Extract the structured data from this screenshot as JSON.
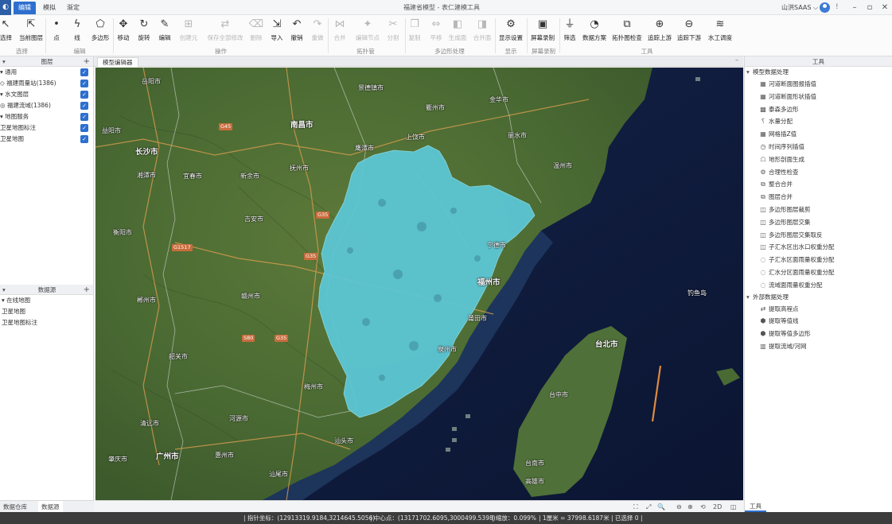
{
  "titlebar": {
    "menu_tabs": [
      "编辑",
      "模拟",
      "渐定"
    ],
    "title": "福建省模型 - 表仁建模工具",
    "user": "山洪SAAS ⌵",
    "info": "!",
    "window_buttons": [
      "–",
      "▫",
      "✕"
    ]
  },
  "ribbon": {
    "tools": [
      {
        "label": "选择",
        "icon": "↖",
        "dim": false
      },
      {
        "label": "当前图层",
        "icon": "⇱",
        "dim": false
      },
      {
        "label": "点",
        "icon": "•",
        "dim": false
      },
      {
        "label": "线",
        "icon": "ϟ",
        "dim": false
      },
      {
        "label": "多边形",
        "icon": "⬠",
        "dim": false
      },
      {
        "label": "移动",
        "icon": "✥",
        "dim": false
      },
      {
        "label": "旋转",
        "icon": "↻",
        "dim": false
      },
      {
        "label": "编辑",
        "icon": "✎",
        "dim": false
      },
      {
        "label": "创建元",
        "icon": "⊞",
        "dim": true
      },
      {
        "label": "保存全部修改",
        "icon": "⇄",
        "dim": true
      },
      {
        "label": "删除",
        "icon": "⌫",
        "dim": true
      },
      {
        "label": "导入",
        "icon": "⇲",
        "dim": false
      },
      {
        "label": "撤销",
        "icon": "↶",
        "dim": false
      },
      {
        "label": "重做",
        "icon": "↷",
        "dim": true
      },
      {
        "label": "合并",
        "icon": "⋈",
        "dim": true
      },
      {
        "label": "编辑节点",
        "icon": "✦",
        "dim": true
      },
      {
        "label": "分割",
        "icon": "✂",
        "dim": true
      },
      {
        "label": "复制",
        "icon": "❐",
        "dim": true
      },
      {
        "label": "平移",
        "icon": "⇔",
        "dim": true
      },
      {
        "label": "生成面",
        "icon": "◧",
        "dim": true
      },
      {
        "label": "合并面",
        "icon": "◨",
        "dim": true
      },
      {
        "label": "显示设置",
        "icon": "⚙",
        "dim": false
      },
      {
        "label": "屏幕录制",
        "icon": "▣",
        "dim": false
      },
      {
        "label": "筛选",
        "icon": "⏚",
        "dim": false
      },
      {
        "label": "数据方案",
        "icon": "◔",
        "dim": false
      },
      {
        "label": "拓扑图检查",
        "icon": "⧉",
        "dim": false
      },
      {
        "label": "追踪上游",
        "icon": "⊕",
        "dim": false
      },
      {
        "label": "追踪下游",
        "icon": "⊖",
        "dim": false
      },
      {
        "label": "水工调度",
        "icon": "≋",
        "dim": false
      }
    ],
    "groups": [
      "选择",
      "编辑",
      "操作",
      "拓扑管",
      "多边形处理",
      "显示",
      "屏幕录制",
      "工具"
    ]
  },
  "layers_panel": {
    "title": "图层",
    "rows": [
      {
        "text": "▾ 通用",
        "checked": true
      },
      {
        "text": "  ◇ 福建雨量站(1386)",
        "checked": true
      },
      {
        "text": "▾ 水文图层",
        "checked": true
      },
      {
        "text": "  ◎ 福建流域(1386)",
        "checked": true
      },
      {
        "text": "▾ 地图服务",
        "checked": true
      },
      {
        "text": "    卫星地图标注",
        "checked": true
      },
      {
        "text": "    卫星地图",
        "checked": true
      }
    ]
  },
  "datasource_panel": {
    "title": "数据源",
    "rows": [
      "▾ 在线地图",
      "  卫星地图",
      "  卫星地图标注"
    ]
  },
  "left_bottom_tabs": [
    "数据仓库",
    "数据源"
  ],
  "document_tab": "模型编辑器",
  "map": {
    "labels": [
      {
        "text": "岳阳市",
        "big": false
      },
      {
        "text": "景德镇市",
        "big": false
      },
      {
        "text": "衢州市",
        "big": false
      },
      {
        "text": "金华市",
        "big": false
      },
      {
        "text": "南昌市",
        "big": true
      },
      {
        "text": "益阳市",
        "big": false
      },
      {
        "text": "上饶市",
        "big": false
      },
      {
        "text": "丽水市",
        "big": false
      },
      {
        "text": "长沙市",
        "big": true
      },
      {
        "text": "鹰潭市",
        "big": false
      },
      {
        "text": "湘潭市",
        "big": false
      },
      {
        "text": "宜春市",
        "big": false
      },
      {
        "text": "新余市",
        "big": false
      },
      {
        "text": "抚州市",
        "big": false
      },
      {
        "text": "温州市",
        "big": false
      },
      {
        "text": "吉安市",
        "big": false
      },
      {
        "text": "衡阳市",
        "big": false
      },
      {
        "text": "宁德市",
        "big": false
      },
      {
        "text": "福州市",
        "big": true
      },
      {
        "text": "郴州市",
        "big": false
      },
      {
        "text": "赣州市",
        "big": false
      },
      {
        "text": "莆田市",
        "big": false
      },
      {
        "text": "钓鱼岛",
        "big": false
      },
      {
        "text": "泉州市",
        "big": false
      },
      {
        "text": "台北市",
        "big": true
      },
      {
        "text": "韶关市",
        "big": false
      },
      {
        "text": "梅州市",
        "big": false
      },
      {
        "text": "台中市",
        "big": false
      },
      {
        "text": "河源市",
        "big": false
      },
      {
        "text": "清远市",
        "big": false
      },
      {
        "text": "汕头市",
        "big": false
      },
      {
        "text": "广州市",
        "big": true
      },
      {
        "text": "惠州市",
        "big": false
      },
      {
        "text": "肇庆市",
        "big": false
      },
      {
        "text": "汕尾市",
        "big": false
      },
      {
        "text": "台南市",
        "big": false
      },
      {
        "text": "高雄市",
        "big": false
      }
    ],
    "road_shields": [
      "G45",
      "G35",
      "G1517",
      "G35",
      "S80",
      "G35"
    ]
  },
  "map_toolbar": [
    "⛶",
    "⤢",
    "🔍",
    "⊖",
    "⊕",
    "⟲",
    "2D",
    "◫"
  ],
  "tools_panel": {
    "title": "工具",
    "groups": [
      {
        "name": "模型数据处理",
        "items": [
          {
            "icon": "▦",
            "label": "河道断面图报插值"
          },
          {
            "icon": "▦",
            "label": "河道断面形状插值"
          },
          {
            "icon": "▩",
            "label": "泰森多边形"
          },
          {
            "icon": "⸮",
            "label": "水量分配"
          },
          {
            "icon": "▦",
            "label": "网格插Z值"
          },
          {
            "icon": "◷",
            "label": "时间序列插值"
          },
          {
            "icon": "☖",
            "label": "地形剖面生成"
          },
          {
            "icon": "⚙",
            "label": "合理性检查"
          },
          {
            "icon": "⧉",
            "label": "整合合并"
          },
          {
            "icon": "⧉",
            "label": "图层合并"
          },
          {
            "icon": "◫",
            "label": "多边形图层裁剪"
          },
          {
            "icon": "◫",
            "label": "多边形图层交集"
          },
          {
            "icon": "◫",
            "label": "多边形图层交集取反"
          },
          {
            "icon": "◫",
            "label": "子汇水区出水口权重分配"
          },
          {
            "icon": "◌",
            "label": "子汇水区面雨量权重分配"
          },
          {
            "icon": "◌",
            "label": "汇水分区面雨量权重分配"
          },
          {
            "icon": "◌",
            "label": "流域面雨量权重分配"
          }
        ]
      },
      {
        "name": "外部数据处理",
        "items": [
          {
            "icon": "⇄",
            "label": "提取高程点"
          },
          {
            "icon": "⬢",
            "label": "提取等值线"
          },
          {
            "icon": "⬢",
            "label": "提取等值多边形"
          },
          {
            "icon": "▥",
            "label": "提取流域/河网"
          }
        ]
      }
    ],
    "bottom_tab": "工具"
  },
  "statusbar": {
    "pointer": "| 指针坐标：(12913319.9184,3214645.5056)",
    "center": "| 中心点：(13171702.6095,3000499.5398)",
    "zoom": "| 缩放：0.099%",
    "scale": "| 1厘米 = 37998.6187米",
    "selected": "| 已选择 0  |"
  },
  "colors": {
    "accent": "#2d6fcf",
    "watershed_fill": "#5cc8d8",
    "statusbar_bg": "#3c3c3c"
  }
}
